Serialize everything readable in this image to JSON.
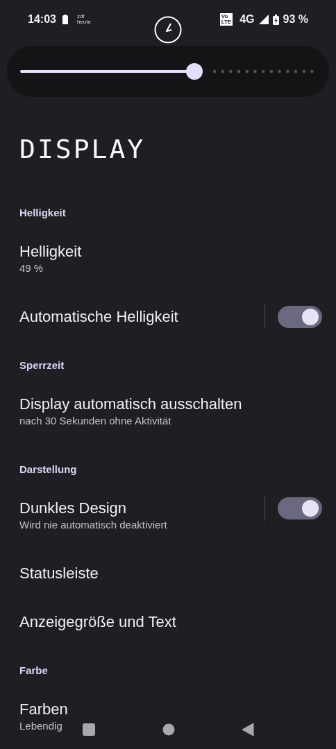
{
  "status_bar": {
    "time": "14:03",
    "notification_text": [
      "zdf",
      "heute"
    ],
    "volte": [
      "Vo",
      "LTE"
    ],
    "network": "4G",
    "battery": "93 %"
  },
  "brightness_slider": {
    "level": 0.59
  },
  "title": "DISPLAY",
  "sections": [
    {
      "header": "Helligkeit",
      "items": [
        {
          "kind": "plain",
          "title": "Helligkeit",
          "subtitle": "49 %"
        },
        {
          "kind": "toggle",
          "title": "Automatische Helligkeit",
          "on": true
        }
      ]
    },
    {
      "header": "Sperrzeit",
      "items": [
        {
          "kind": "plain",
          "title": "Display automatisch ausschalten",
          "subtitle": "nach 30 Sekunden ohne Aktivität"
        }
      ]
    },
    {
      "header": "Darstellung",
      "items": [
        {
          "kind": "toggle",
          "title": "Dunkles Design",
          "subtitle": "Wird nie automatisch deaktiviert",
          "on": true
        },
        {
          "kind": "plain",
          "title": "Statusleiste"
        },
        {
          "kind": "plain",
          "title": "Anzeigegröße und Text"
        }
      ]
    },
    {
      "header": "Farbe",
      "items": [
        {
          "kind": "plain",
          "title": "Farben",
          "subtitle": "Lebendig"
        }
      ]
    }
  ]
}
